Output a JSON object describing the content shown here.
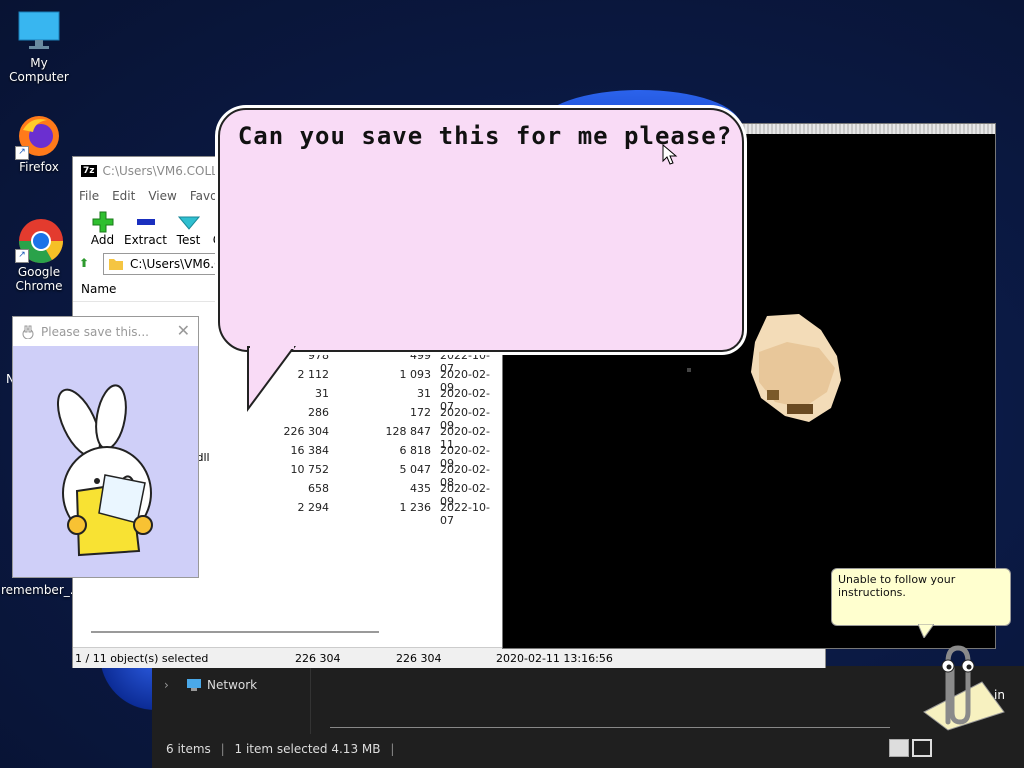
{
  "desktop": {
    "icons": [
      {
        "label": "My Computer",
        "icon": "monitor-icon"
      },
      {
        "label": "Firefox",
        "icon": "firefox-icon"
      },
      {
        "label": "Google Chrome",
        "icon": "chrome-icon"
      },
      {
        "label": "remember_...",
        "icon": "file-icon"
      }
    ],
    "partial_letter_n": "N",
    "partial_label_in": "in"
  },
  "sevenzip": {
    "title": "C:\\Users\\VM6.COLLAI",
    "logo": "7z",
    "menu": [
      "File",
      "Edit",
      "View",
      "Favori"
    ],
    "tools": [
      {
        "label": "Add",
        "icon": "plus-icon",
        "color": "#2fbf2f"
      },
      {
        "label": "Extract",
        "icon": "minus-icon",
        "color": "#1a2fbf"
      },
      {
        "label": "Test",
        "icon": "check-icon",
        "color": "#2fbfd0"
      },
      {
        "label": "C",
        "icon": "copy-icon"
      }
    ],
    "address": "C:\\Users\\VM6.C",
    "column_name": "Name",
    "partial_filename": ".dll",
    "rows": [
      {
        "size": "978",
        "packed": "499",
        "date": "2022-10-07"
      },
      {
        "size": "2 112",
        "packed": "1 093",
        "date": "2020-02-09"
      },
      {
        "size": "31",
        "packed": "31",
        "date": "2020-02-07"
      },
      {
        "size": "286",
        "packed": "172",
        "date": "2020-02-09"
      },
      {
        "size": "226 304",
        "packed": "128 847",
        "date": "2020-02-11"
      },
      {
        "size": "16 384",
        "packed": "6 818",
        "date": "2020-02-09"
      },
      {
        "size": "10 752",
        "packed": "5 047",
        "date": "2020-02-08"
      },
      {
        "size": "658",
        "packed": "435",
        "date": "2020-02-09"
      },
      {
        "size": "2 294",
        "packed": "1 236",
        "date": "2022-10-07"
      }
    ],
    "status": {
      "selected": "1 / 11 object(s) selected",
      "size": "226 304",
      "packed": "226 304",
      "modified": "2020-02-11 13:16:56"
    }
  },
  "bubble": {
    "text": "Can you save this for me please?"
  },
  "bunny_window": {
    "title": "Please save this...",
    "close": "✕"
  },
  "explorer": {
    "network_label": "Network",
    "items_count": "6 items",
    "selected_info": "1 item selected  4.13 MB"
  },
  "assistant": {
    "tooltip": "Unable to follow your instructions."
  },
  "colors": {
    "bubble_bg": "#f9dbf6",
    "bunny_bg": "#cfcff8",
    "tooltip_bg": "#ffffcf"
  }
}
